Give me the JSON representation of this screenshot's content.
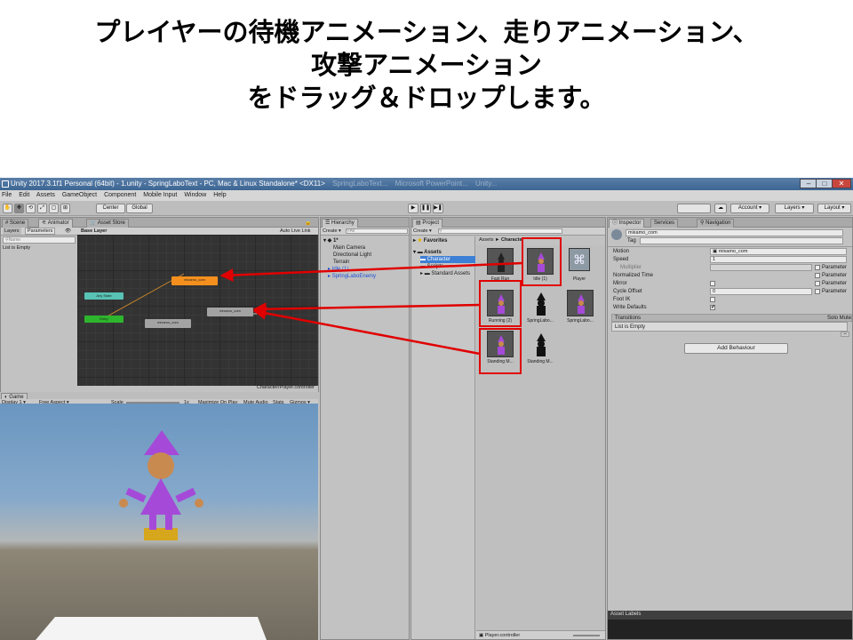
{
  "caption": {
    "line1": "プレイヤーの待機アニメーション、走りアニメーション、",
    "line2": "攻撃アニメーション",
    "line3": "をドラッグ＆ドロップします。"
  },
  "window": {
    "title": "Unity 2017.3.1f1 Personal (64bit) - 1.unity - SpringLaboText - PC, Mac & Linux Standalone* <DX11>",
    "bg_tabs": [
      "SpringLaboText...",
      "Microsoft PowerPoint...",
      "Unity..."
    ]
  },
  "menu": [
    "File",
    "Edit",
    "Assets",
    "GameObject",
    "Component",
    "Mobile Input",
    "Window",
    "Help"
  ],
  "toolbar": {
    "center": "Center",
    "global": "Global",
    "play": "▶",
    "pause": "❚❚",
    "step": "▶❚",
    "cloud": "☁",
    "account": "Account",
    "layers": "Layers",
    "layout": "Layout"
  },
  "animator": {
    "tab_scene": "Scene",
    "tab_animator": "Animator",
    "tab_asset_store": "Asset Store",
    "tab_layers": "Layers",
    "tab_parameters": "Parameters",
    "search_placeholder": "Name",
    "list_empty": "List is Empty",
    "breadcrumb": "Base Layer",
    "auto_live_link": "Auto Live Link",
    "footer_path": "Character/Player.controller",
    "nodes": {
      "any_state": "Any State",
      "entry": "Entry",
      "orange_state": "mixamo_com",
      "gray_state_1": "mixamo_com",
      "gray_state_2": "mixamo_com"
    }
  },
  "hierarchy": {
    "tab": "Hierarchy",
    "create": "Create",
    "search_placeholder": "All",
    "scene": "1*",
    "items": [
      "Main Camera",
      "Directional Light",
      "Terrain",
      "Idle (1)",
      "SpringLaboEnemy"
    ]
  },
  "project": {
    "tab": "Project",
    "create": "Create",
    "favorites": "Favorites",
    "assets": "Assets",
    "tree": [
      "Character",
      "Scripts",
      "Standard Assets"
    ],
    "breadcrumb_root": "Assets",
    "breadcrumb_sep": "►",
    "breadcrumb_leaf": "Character",
    "thumbs": [
      {
        "label": "Fast Run"
      },
      {
        "label": "Idle (1)"
      },
      {
        "label": "Player"
      },
      {
        "label": "Running (2)"
      },
      {
        "label": "SpringLabo..."
      },
      {
        "label": "SpringLabo..."
      },
      {
        "label": "Standing M..."
      },
      {
        "label": "Standing M..."
      }
    ],
    "footer": "Player.controller"
  },
  "inspector": {
    "tab": "Inspector",
    "tab_services": "Services",
    "tab_navigation": "Navigation",
    "name_value": "mixamo_com",
    "tag_label": "Tag",
    "fields": {
      "motion_label": "Motion",
      "motion_value": "mixamo_com",
      "speed_label": "Speed",
      "speed_value": "1",
      "multiplier_label": "Multiplier",
      "parameter": "Parameter",
      "normalized_time_label": "Normalized Time",
      "mirror_label": "Mirror",
      "cycle_offset_label": "Cycle Offset",
      "cycle_offset_value": "0",
      "foot_ik_label": "Foot IK",
      "write_defaults_label": "Write Defaults",
      "check": "✔"
    },
    "transitions_label": "Transitions",
    "solo_mute": "Solo Mute",
    "transitions_empty": "List is Empty",
    "add_behaviour": "Add Behaviour",
    "asset_labels": "Asset Labels"
  },
  "game": {
    "tab": "Game",
    "display": "Display 1",
    "aspect": "Free Aspect",
    "scale_label": "Scale",
    "scale_value": "1x",
    "maximize": "Maximize On Play",
    "mute": "Mute Audio",
    "stats": "Stats",
    "gizmos": "Gizmos"
  },
  "colors": {
    "annotation": "#e00000",
    "orange_state": "#f5901e",
    "entry_state": "#2db52d",
    "any_state": "#58c2b5",
    "character_hat": "#a54ad8",
    "character_head": "#c98a50"
  }
}
